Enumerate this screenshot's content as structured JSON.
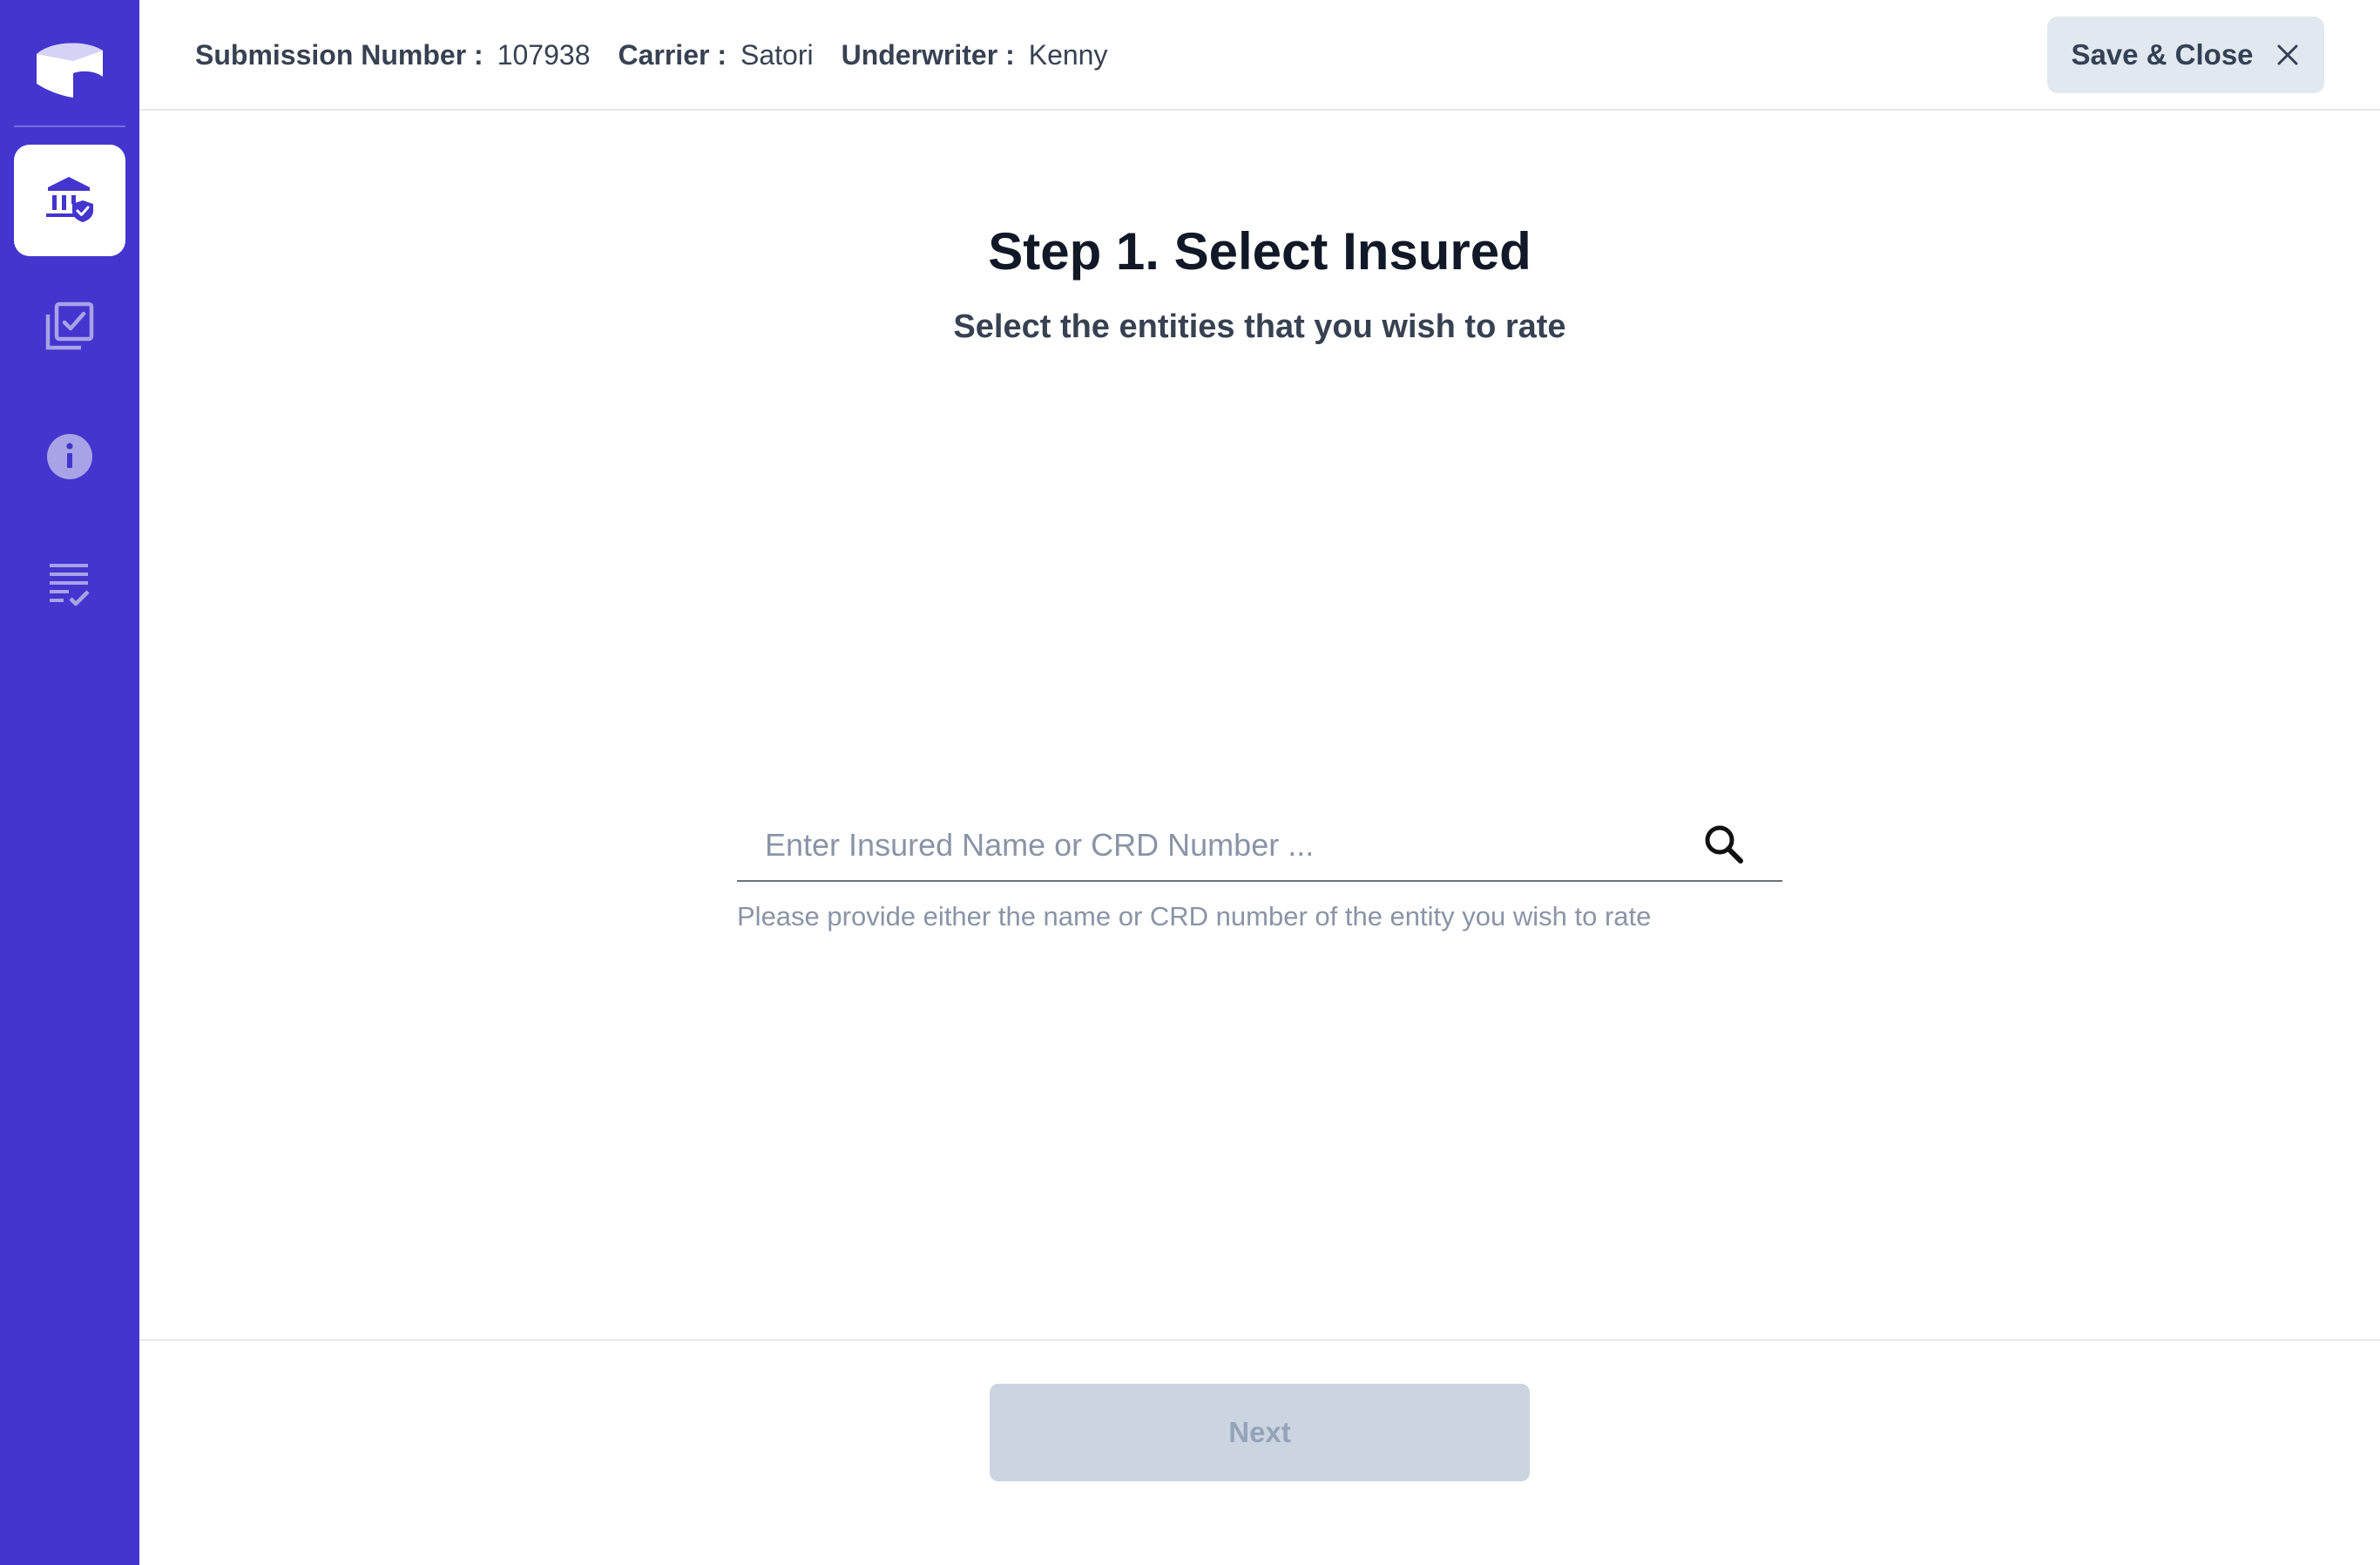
{
  "colors": {
    "sidebar_bg": "#4335CE",
    "accent": "#4335CE",
    "inactive_icon": "#A7A3E6",
    "button_bg": "#E2E8F0",
    "disabled_bg": "#CBD5E1"
  },
  "sidebar": {
    "items": [
      {
        "icon": "bank-shield-icon",
        "active": true
      },
      {
        "icon": "checklist-copy-icon",
        "active": false
      },
      {
        "icon": "info-icon",
        "active": false
      },
      {
        "icon": "list-check-icon",
        "active": false
      }
    ]
  },
  "header": {
    "submission_label": "Submission Number :",
    "submission_value": "107938",
    "carrier_label": "Carrier :",
    "carrier_value": "Satori",
    "underwriter_label": "Underwriter :",
    "underwriter_value": "Kenny",
    "save_close_label": "Save & Close"
  },
  "main": {
    "title": "Step 1. Select Insured",
    "subtitle": "Select the entities that you wish to rate",
    "search": {
      "placeholder": "Enter Insured Name or CRD Number ...",
      "value": "",
      "helper": "Please provide either the name or CRD number of the entity you wish to rate"
    }
  },
  "footer": {
    "next_label": "Next"
  }
}
